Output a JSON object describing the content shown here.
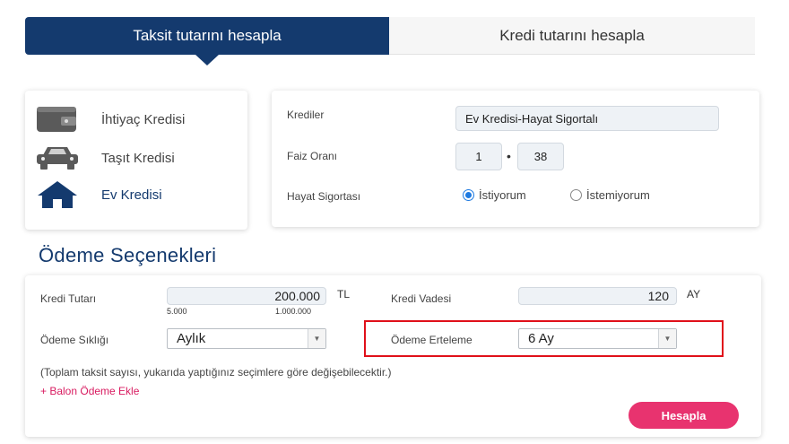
{
  "tabs": {
    "active": "Taksit tutarını hesapla",
    "inactive": "Kredi tutarını hesapla"
  },
  "credit_types": [
    {
      "label": "İhtiyaç Kredisi",
      "icon": "wallet-icon"
    },
    {
      "label": "Taşıt Kredisi",
      "icon": "car-icon"
    },
    {
      "label": "Ev Kredisi",
      "icon": "house-icon",
      "selected": true
    }
  ],
  "form": {
    "krediler_label": "Krediler",
    "krediler_value": "Ev Kredisi-Hayat Sigortalı",
    "faiz_label": "Faiz Oranı",
    "faiz_int": "1",
    "faiz_dec": "38",
    "hayat_label": "Hayat Sigortası",
    "radio_yes": "İstiyorum",
    "radio_no": "İstemiyorum",
    "radio_selected": "İstiyorum"
  },
  "payment": {
    "title": "Ödeme Seçenekleri",
    "tutar_label": "Kredi Tutarı",
    "tutar_value": "200.000",
    "tutar_unit": "TL",
    "tutar_min": "5.000",
    "tutar_max": "1.000.000",
    "vade_label": "Kredi Vadesi",
    "vade_value": "120",
    "vade_unit": "AY",
    "siklik_label": "Ödeme Sıklığı",
    "siklik_value": "Aylık",
    "erteleme_label": "Ödeme Erteleme",
    "erteleme_value": "6 Ay",
    "note": "(Toplam taksit sayısı, yukarıda yaptığınız seçimlere göre değişebilecektir.)",
    "balon": "+ Balon Ödeme Ekle",
    "button": "Hesapla"
  },
  "colors": {
    "navy": "#143a6e",
    "pink": "#e8336f",
    "highlight": "#e0101a"
  }
}
